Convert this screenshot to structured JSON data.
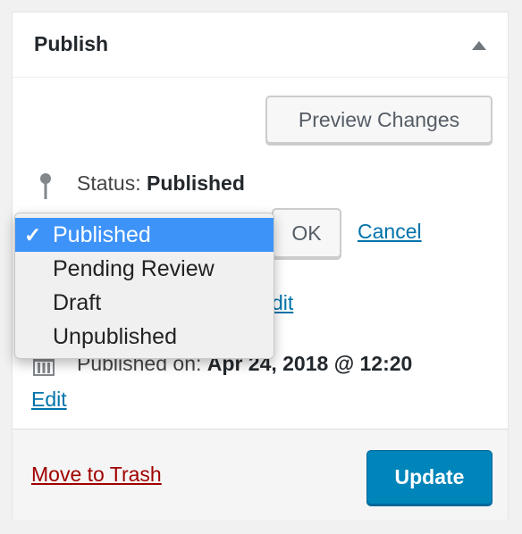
{
  "panel": {
    "title": "Publish",
    "preview_label": "Preview Changes"
  },
  "status": {
    "label": "Status:",
    "value": "Published",
    "ok_label": "OK",
    "cancel_label": "Cancel",
    "options": [
      {
        "label": "Published",
        "selected": true,
        "check": "✓"
      },
      {
        "label": "Pending Review",
        "selected": false
      },
      {
        "label": "Draft",
        "selected": false
      },
      {
        "label": "Unpublished",
        "selected": false
      }
    ]
  },
  "visibility": {
    "edit_partial": "dit"
  },
  "published": {
    "label": "Published on:",
    "value": "Apr 24, 2018 @ 12:20",
    "edit_label": "Edit"
  },
  "footer": {
    "trash_label": "Move to Trash",
    "update_label": "Update"
  },
  "colors": {
    "link": "#0073aa",
    "trash": "#a00000",
    "primary": "#0085ba",
    "selected_option": "#3d93f8"
  },
  "icons": {
    "toggle": "triangle-up-icon",
    "status": "pin-icon",
    "published": "calendar-icon"
  }
}
